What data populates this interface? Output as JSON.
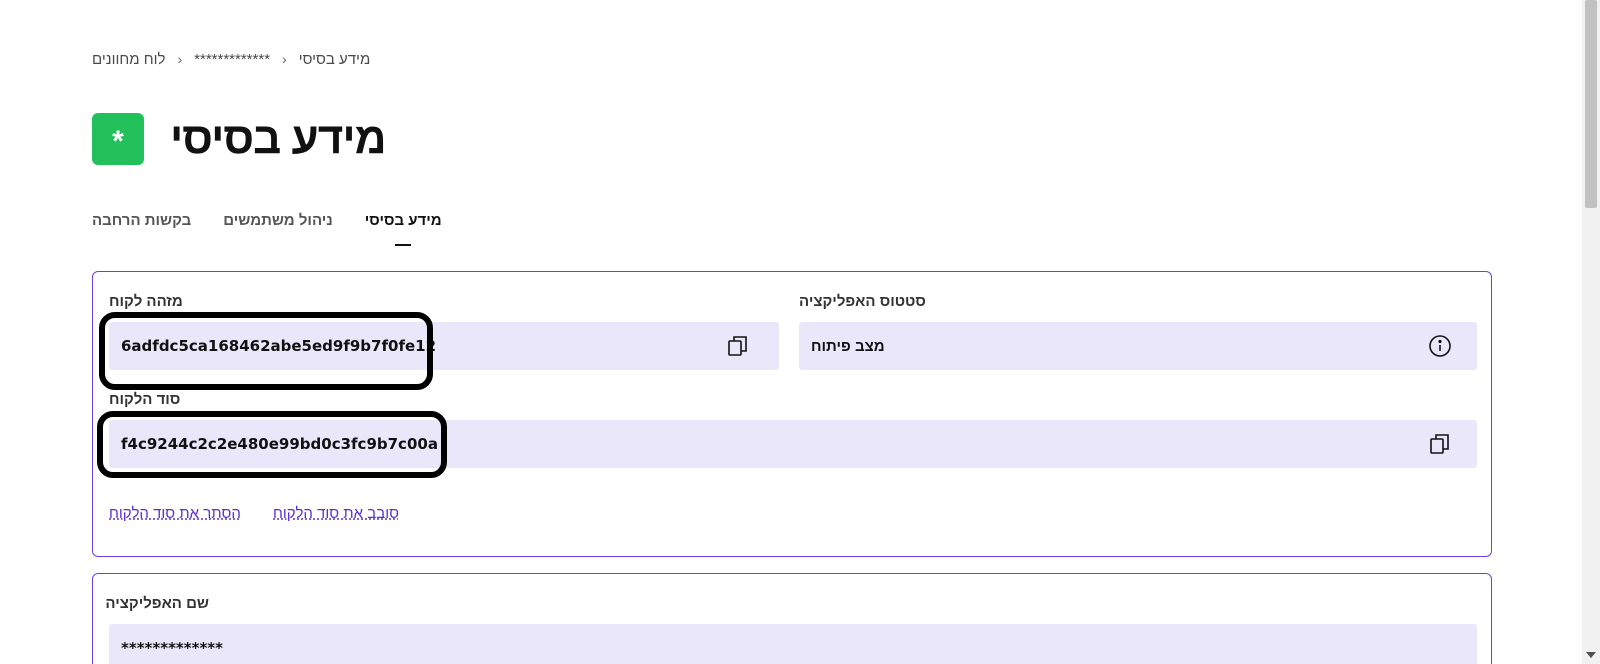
{
  "breadcrumb": {
    "items": [
      "מידע בסיסי",
      "*************",
      "לוח מחוונים"
    ],
    "separator": "‹"
  },
  "header": {
    "title": "מידע בסיסי",
    "badge_symbol": "*",
    "badge_color": "#22c05a"
  },
  "tabs": [
    {
      "label": "מידע בסיסי",
      "active": true
    },
    {
      "label": "ניהול משתמשים",
      "active": false
    },
    {
      "label": "בקשות הרחבה",
      "active": false
    }
  ],
  "credentials": {
    "client_id_label": "מזהה לקוח",
    "client_id_value": "6adfdc5ca168462abe5ed9f9b7f0fe12",
    "app_status_label": "סטטוס האפליקציה",
    "app_status_value": "מצב פיתוח",
    "client_secret_label": "סוד הלקוח",
    "client_secret_value": "f4c9244c2c2e480e99bd0c3fc9b7c00a",
    "hide_secret_link": "הסתר את סוד הלקוח",
    "rotate_secret_link": "סובב את סוד הלקוח"
  },
  "app_info": {
    "app_name_label": "שם האפליקציה",
    "app_name_value": "*************"
  },
  "icons": {
    "copy": "copy-icon",
    "info": "info-icon"
  },
  "colors": {
    "accent": "#6c3fe0",
    "field_bg": "#ebe7fb",
    "link": "#5a2fd6"
  }
}
